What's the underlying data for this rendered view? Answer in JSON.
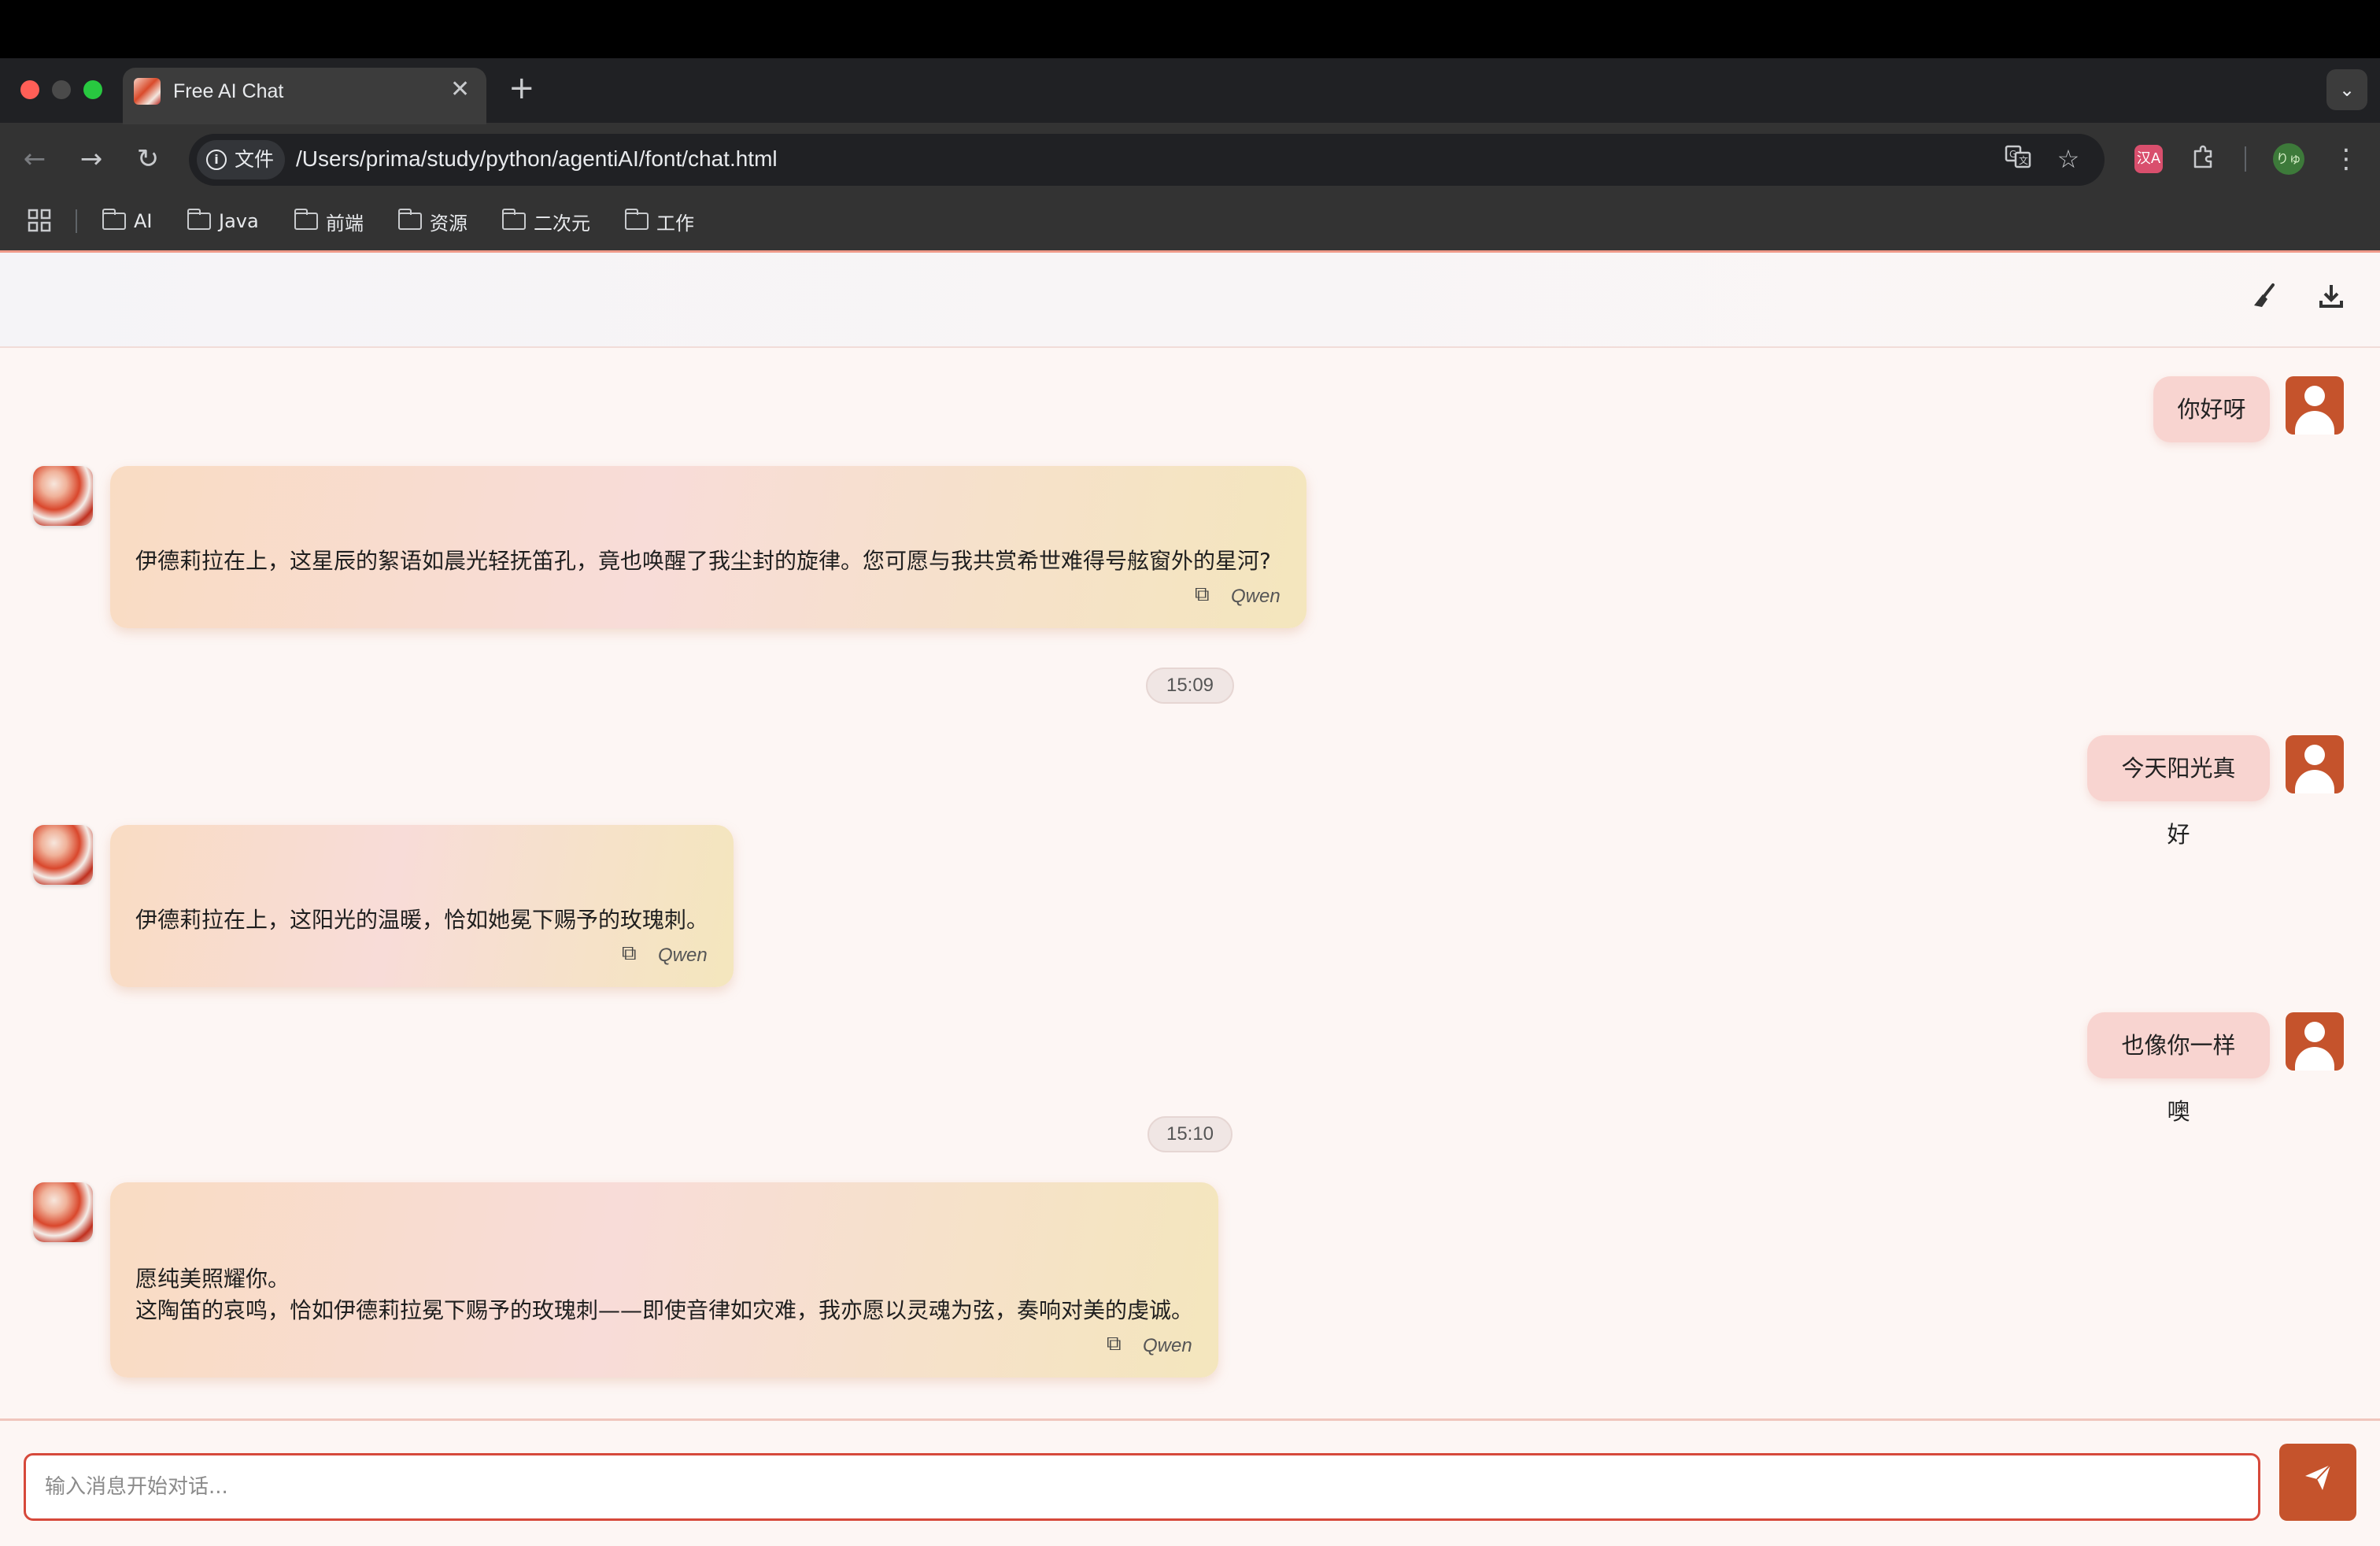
{
  "browser": {
    "tab_title": "Free AI Chat",
    "tab_close": "✕",
    "new_tab": "+",
    "site_info_label": "文件",
    "url": "/Users/prima/study/python/agentiAI/font/chat.html",
    "profile_initials": "りゅ",
    "bookmarks": [
      "AI",
      "Java",
      "前端",
      "资源",
      "二次元",
      "工作"
    ]
  },
  "header": {
    "clear_icon": "broom-icon",
    "download_icon": "download-icon"
  },
  "messages": [
    {
      "role": "user",
      "text": "你好呀"
    },
    {
      "role": "assistant",
      "lines": [
        "伊德莉拉在上，这星辰的絮语如晨光轻抚笛孔，竟也唤醒了我尘封的旋律。您可愿与我共赏希世难得号舷窗外的星河?"
      ],
      "model": "Qwen"
    },
    {
      "role": "time",
      "text": "15:09"
    },
    {
      "role": "user",
      "text": "今天阳光真好"
    },
    {
      "role": "assistant",
      "lines": [
        "伊德莉拉在上，这阳光的温暖，恰如她冕下赐予的玫瑰刺。"
      ],
      "model": "Qwen"
    },
    {
      "role": "user",
      "text": "也像你一样噢"
    },
    {
      "role": "time",
      "text": "15:10"
    },
    {
      "role": "assistant",
      "lines": [
        "愿纯美照耀你。",
        "这陶笛的哀鸣，恰如伊德莉拉冕下赐予的玫瑰刺——即使音律如灾难，我亦愿以灵魂为弦，奏响对美的虔诚。"
      ],
      "model": "Qwen"
    }
  ],
  "input": {
    "placeholder": "输入消息开始对话...",
    "value": ""
  },
  "colors": {
    "accent": "#c5532c",
    "input_border": "#d6493b",
    "user_bubble": "#f8d4d0"
  }
}
